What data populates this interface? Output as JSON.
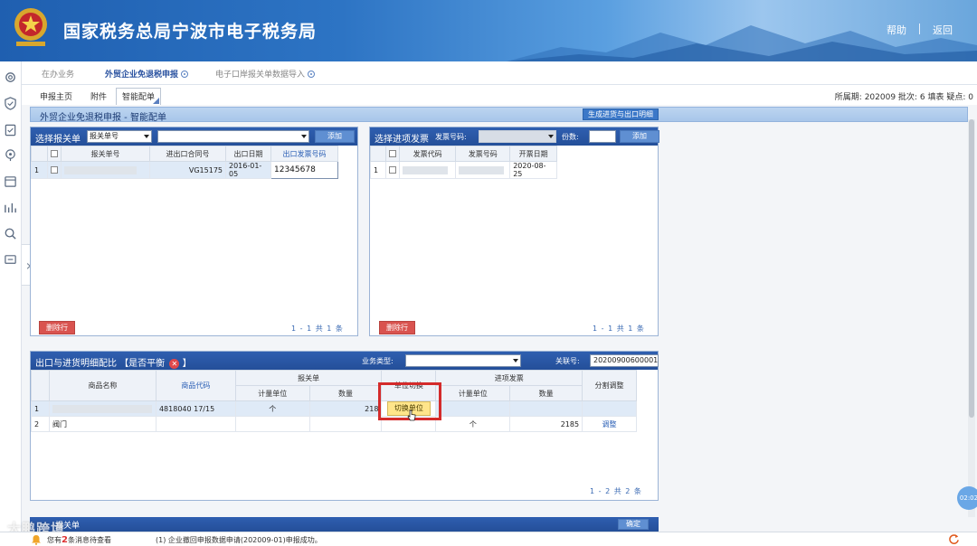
{
  "header": {
    "emblem_text": "宁波税务",
    "title": "国家税务总局宁波市电子税务局",
    "help": "帮助",
    "back": "返回"
  },
  "tabs": [
    {
      "label": "在办业务"
    },
    {
      "label": "外贸企业免退税申报"
    },
    {
      "label": "电子口岸报关单数据导入"
    }
  ],
  "subtabs": [
    {
      "label": "申报主页"
    },
    {
      "label": "附件"
    },
    {
      "label": "智能配单"
    }
  ],
  "period_info": {
    "period_label": "所属期:",
    "period": "202009",
    "batch_label": "批次:",
    "batch": "6",
    "filler_label": "填表",
    "doubt_label": "疑点:",
    "doubt": "0"
  },
  "page": {
    "title": "外贸企业免退税申报 - 智能配单",
    "generate_button": "生成进货与出口明细"
  },
  "customs_panel": {
    "title": "选择报关单",
    "select_value": "报关单号",
    "add_button": "添加",
    "columns": [
      "报关单号",
      "进出口合同号",
      "出口日期",
      "出口发票号码"
    ],
    "rows": [
      {
        "index": "1",
        "contract": "VG15175",
        "date": "2016-01-05",
        "invoice": "12345678"
      }
    ],
    "delete_button": "删除行",
    "pager": "1 - 1  共 1 条"
  },
  "invoice_panel": {
    "title": "选择进项发票",
    "invoice_no_label": "发票号码:",
    "copies_label": "份数:",
    "add_button": "添加",
    "columns": [
      "发票代码",
      "发票号码",
      "开票日期"
    ],
    "rows": [
      {
        "index": "1",
        "date": "2020-08-25"
      }
    ],
    "delete_button": "删除行",
    "pager": "1 - 1  共 1 条"
  },
  "detail_panel": {
    "title": "出口与进货明细配比",
    "balance_label": "【是否平衡",
    "balance_close": "】",
    "business_type_label": "业务类型:",
    "link_no_label": "关联号:",
    "link_no": "20200900600001",
    "col_name": "商品名称",
    "col_code": "商品代码",
    "group_customs": "报关单",
    "group_invoice": "进项发票",
    "col_unit": "计量单位",
    "col_qty": "数量",
    "col_switch": "单位切换",
    "col_split": "分割调整",
    "rows": [
      {
        "index": "1",
        "name": "",
        "code": "4818040 17/15",
        "unit": "个",
        "qty": "218",
        "switch": "切换单位",
        "inv_unit": "",
        "inv_qty": "",
        "split": ""
      },
      {
        "index": "2",
        "name": "阀门",
        "code": "",
        "unit": "",
        "qty": "",
        "switch": "",
        "inv_unit": "个",
        "inv_qty": "2185",
        "split": "调整"
      }
    ],
    "pager": "1 - 2  共 2 条"
  },
  "bottom_panel": {
    "title": "报关单",
    "confirm_button": "确定"
  },
  "status": {
    "notice_prefix": "您有",
    "notice_count": "2",
    "notice_suffix": "条消息待查看",
    "message": "(1)  企业撤回申报数据申请(202009-01)申报成功。"
  },
  "floating_time": "02:02",
  "watermark": "大鹏跨境",
  "colors": {
    "header_blue": "#2d74c4",
    "panel_head": "#2f5fb0",
    "delete_red": "#d9534f",
    "highlight_yellow": "#ffe58a",
    "frame_red": "#d42b2b"
  }
}
